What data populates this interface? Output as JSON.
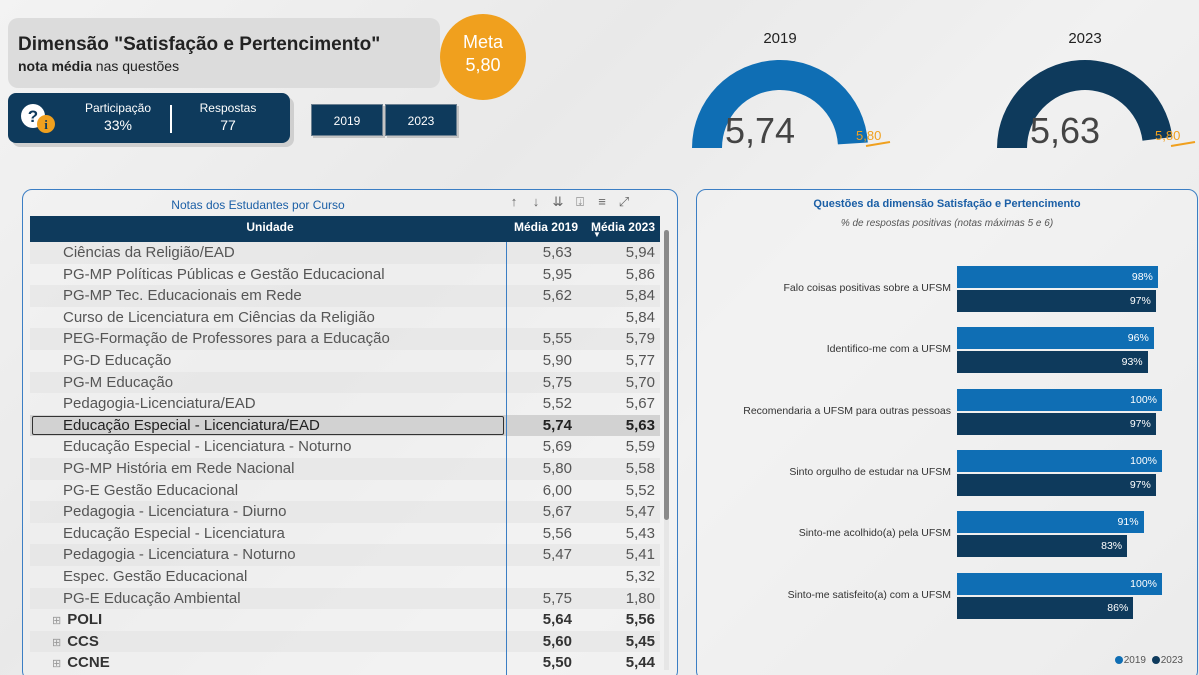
{
  "header": {
    "title": "Dimensão \"Satisfação e Pertencimento\"",
    "subtitle_bold": "nota média",
    "subtitle_rest": " nas questões",
    "meta_label": "Meta",
    "meta_value": "5,80"
  },
  "kpis": {
    "participation_label": "Participação",
    "participation_value": "33%",
    "responses_label": "Respostas",
    "responses_value": "77"
  },
  "year_buttons": [
    "2019",
    "2023"
  ],
  "gauges": [
    {
      "year": "2019",
      "value": "5,74",
      "target": "5,80",
      "color": "#0f6eb4",
      "fraction": 0.98
    },
    {
      "year": "2023",
      "value": "5,63",
      "target": "5,80",
      "color": "#0e3a5c",
      "fraction": 0.96
    }
  ],
  "table": {
    "title": "Notas dos Estudantes por Curso",
    "columns": {
      "unit": "Unidade",
      "m2019": "Média 2019",
      "m2023": "Média 2023"
    },
    "rows": [
      {
        "unit": "Ciências da Religião/EAD",
        "m2019": "5,63",
        "m2023": "5,94"
      },
      {
        "unit": "PG-MP Políticas Públicas e Gestão Educacional",
        "m2019": "5,95",
        "m2023": "5,86"
      },
      {
        "unit": "PG-MP Tec. Educacionais em Rede",
        "m2019": "5,62",
        "m2023": "5,84"
      },
      {
        "unit": "Curso de Licenciatura em Ciências da Religião",
        "m2019": "",
        "m2023": "5,84"
      },
      {
        "unit": "PEG-Formação de Professores para a Educação",
        "m2019": "5,55",
        "m2023": "5,79"
      },
      {
        "unit": "PG-D Educação",
        "m2019": "5,90",
        "m2023": "5,77"
      },
      {
        "unit": "PG-M Educação",
        "m2019": "5,75",
        "m2023": "5,70"
      },
      {
        "unit": "Pedagogia-Licenciatura/EAD",
        "m2019": "5,52",
        "m2023": "5,67"
      },
      {
        "unit": "Educação Especial - Licenciatura/EAD",
        "m2019": "5,74",
        "m2023": "5,63",
        "selected": true
      },
      {
        "unit": "Educação Especial - Licenciatura - Noturno",
        "m2019": "5,69",
        "m2023": "5,59"
      },
      {
        "unit": "PG-MP História em Rede Nacional",
        "m2019": "5,80",
        "m2023": "5,58"
      },
      {
        "unit": "PG-E Gestão Educacional",
        "m2019": "6,00",
        "m2023": "5,52"
      },
      {
        "unit": "Pedagogia - Licenciatura - Diurno",
        "m2019": "5,67",
        "m2023": "5,47"
      },
      {
        "unit": "Educação Especial - Licenciatura",
        "m2019": "5,56",
        "m2023": "5,43"
      },
      {
        "unit": "Pedagogia - Licenciatura - Noturno",
        "m2019": "5,47",
        "m2023": "5,41"
      },
      {
        "unit": "Espec. Gestão Educacional",
        "m2019": "",
        "m2023": "5,32"
      },
      {
        "unit": "PG-E Educação Ambiental",
        "m2019": "5,75",
        "m2023": "1,80"
      },
      {
        "unit": "POLI",
        "m2019": "5,64",
        "m2023": "5,56",
        "group": true
      },
      {
        "unit": "CCS",
        "m2019": "5,60",
        "m2023": "5,45",
        "group": true
      },
      {
        "unit": "CCNE",
        "m2019": "5,50",
        "m2023": "5,44",
        "group": true
      }
    ]
  },
  "chart": {
    "title": "Questões da dimensão Satisfação e Pertencimento",
    "subtitle": "% de respostas positivas (notas máximas 5 e 6)",
    "legend": [
      "2019",
      "2023"
    ]
  },
  "chart_data": {
    "type": "bar",
    "orientation": "horizontal",
    "categories": [
      "Falo coisas positivas sobre a UFSM",
      "Identifico-me com a UFSM",
      "Recomendaria a UFSM para outras pessoas",
      "Sinto orgulho de estudar na UFSM",
      "Sinto-me acolhido(a) pela UFSM",
      "Sinto-me satisfeito(a) com a UFSM"
    ],
    "series": [
      {
        "name": "2019",
        "values": [
          98,
          96,
          100,
          100,
          91,
          100
        ],
        "labels": [
          "98%",
          "96%",
          "100%",
          "100%",
          "91%",
          "100%"
        ],
        "color": "#0f6eb4"
      },
      {
        "name": "2023",
        "values": [
          97,
          93,
          97,
          97,
          83,
          86
        ],
        "labels": [
          "97%",
          "93%",
          "97%",
          "97%",
          "83%",
          "86%"
        ],
        "color": "#0e3a5c"
      }
    ],
    "xlim": [
      0,
      100
    ]
  }
}
